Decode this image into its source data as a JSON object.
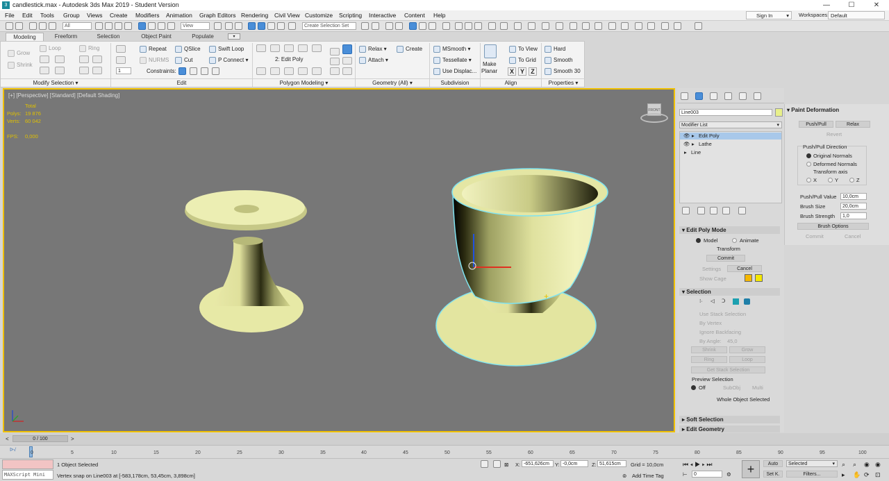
{
  "titlebar": {
    "title": "candlestick.max - Autodesk 3ds Max 2019 - Student Version",
    "min": "—",
    "max": "☐",
    "close": "✕"
  },
  "menu": [
    "File",
    "Edit",
    "Tools",
    "Group",
    "Views",
    "Create",
    "Modifiers",
    "Animation",
    "Graph Editors",
    "Rendering",
    "Civil View",
    "Customize",
    "Scripting",
    "Interactive",
    "Content",
    "Help"
  ],
  "menu_right": {
    "signin": "Sign In",
    "workspaces_label": "Workspaces:",
    "workspace": "Default"
  },
  "toolbar": {
    "filter": "All",
    "ref_coord": "View",
    "selection_set": "Create Selection Set"
  },
  "ribbon_tabs": [
    "Modeling",
    "Freeform",
    "Selection",
    "Object Paint",
    "Populate"
  ],
  "ribbon": {
    "modify_selection": {
      "grow": "Grow",
      "shrink": "Shrink",
      "loop": "Loop",
      "ring": "Ring",
      "label": "Modify Selection ▾",
      "spin": "1"
    },
    "edit": {
      "repeat": "Repeat",
      "qslice": "QSlice",
      "swift_loop": "Swift Loop",
      "nurms": "NURMS",
      "cut": "Cut",
      "p_connect": "P Connect",
      "constraints": "Constraints:",
      "label": "Edit"
    },
    "polygon": {
      "title": "2: Edit Poly",
      "label": "Polygon Modeling ▾"
    },
    "geometry": {
      "relax": "Relax",
      "create": "Create",
      "attach": "Attach",
      "label": "Geometry (All) ▾"
    },
    "subdivision": {
      "msmooth": "MSmooth",
      "tessellate": "Tessellate",
      "use_displace": "Use Displac...",
      "label": "Subdivision"
    },
    "align": {
      "make_planar": "Make",
      "make_planar2": "Planar",
      "to_view": "To View",
      "to_grid": "To Grid",
      "x": "X",
      "y": "Y",
      "z": "Z",
      "label": "Align"
    },
    "properties": {
      "hard": "Hard",
      "smooth": "Smooth",
      "smooth30": "Smooth 30",
      "label": "Properties ▾"
    }
  },
  "viewport": {
    "label": "[+] [Perspective] [Standard] [Default Shading]",
    "stats": {
      "total": "Total",
      "polys_label": "Polys:",
      "polys": "19 876",
      "verts_label": "Verts:",
      "verts": "60 042",
      "fps_label": "FPS:",
      "fps": "0,000"
    },
    "viewcube": "FRONT"
  },
  "panel": {
    "object_name": "Line003",
    "object_color": "#e8f08a",
    "modifier_list": "Modifier List",
    "stack": [
      "Edit Poly",
      "Lathe",
      "Line"
    ],
    "edit_poly_mode": {
      "header": "Edit Poly Mode",
      "model": "Model",
      "animate": "Animate",
      "transform": "Transform",
      "commit": "Commit",
      "settings": "Settings",
      "cancel": "Cancel",
      "show_cage": "Show Cage"
    },
    "selection": {
      "header": "Selection",
      "use_stack": "Use Stack Selection",
      "by_vertex": "By Vertex",
      "ignore_bf": "Ignore Backfacing",
      "by_angle": "By Angle:",
      "angle": "45,0",
      "shrink": "Shrink",
      "grow": "Grow",
      "ring": "Ring",
      "loop": "Loop",
      "get_stack": "Get Stack Selection",
      "preview": "Preview Selection",
      "off": "Off",
      "subobj": "SubObj",
      "multi": "Multi",
      "whole": "Whole Object Selected"
    },
    "soft_selection": "Soft Selection",
    "edit_geometry": "Edit Geometry"
  },
  "paint": {
    "header": "Paint Deformation",
    "push_pull": "Push/Pull",
    "relax": "Relax",
    "revert": "Revert",
    "direction": "Push/Pull Direction",
    "original": "Original Normals",
    "deformed": "Deformed Normals",
    "transform_axis": "Transform axis",
    "x": "X",
    "y": "Y",
    "z": "Z",
    "pp_value_label": "Push/Pull Value",
    "pp_value": "10,0cm",
    "brush_size_label": "Brush Size",
    "brush_size": "20,0cm",
    "brush_strength_label": "Brush Strength",
    "brush_strength": "1,0",
    "brush_options": "Brush Options",
    "commit": "Commit",
    "cancel": "Cancel"
  },
  "timeline": {
    "frame": "0 / 100",
    "ticks": [
      "0",
      "5",
      "10",
      "15",
      "20",
      "25",
      "30",
      "35",
      "40",
      "45",
      "50",
      "55",
      "60",
      "65",
      "70",
      "75",
      "80",
      "85",
      "90",
      "95",
      "100"
    ]
  },
  "status": {
    "maxscript": "MAXScript Mini",
    "selected": "1 Object Selected",
    "prompt": "Vertex snap on Line003 at [-583,178cm, 53,45cm, 3,898cm]",
    "x_label": "X:",
    "x": "-651,626cm",
    "y_label": "Y:",
    "y": "-0,0cm",
    "z_label": "Z:",
    "z": "51,615cm",
    "grid": "Grid = 10,0cm",
    "add_time_tag": "Add Time Tag",
    "auto": "Auto",
    "set_key": "Set K.",
    "selected_dd": "Selected",
    "filters": "Filters...",
    "frame": "0"
  }
}
